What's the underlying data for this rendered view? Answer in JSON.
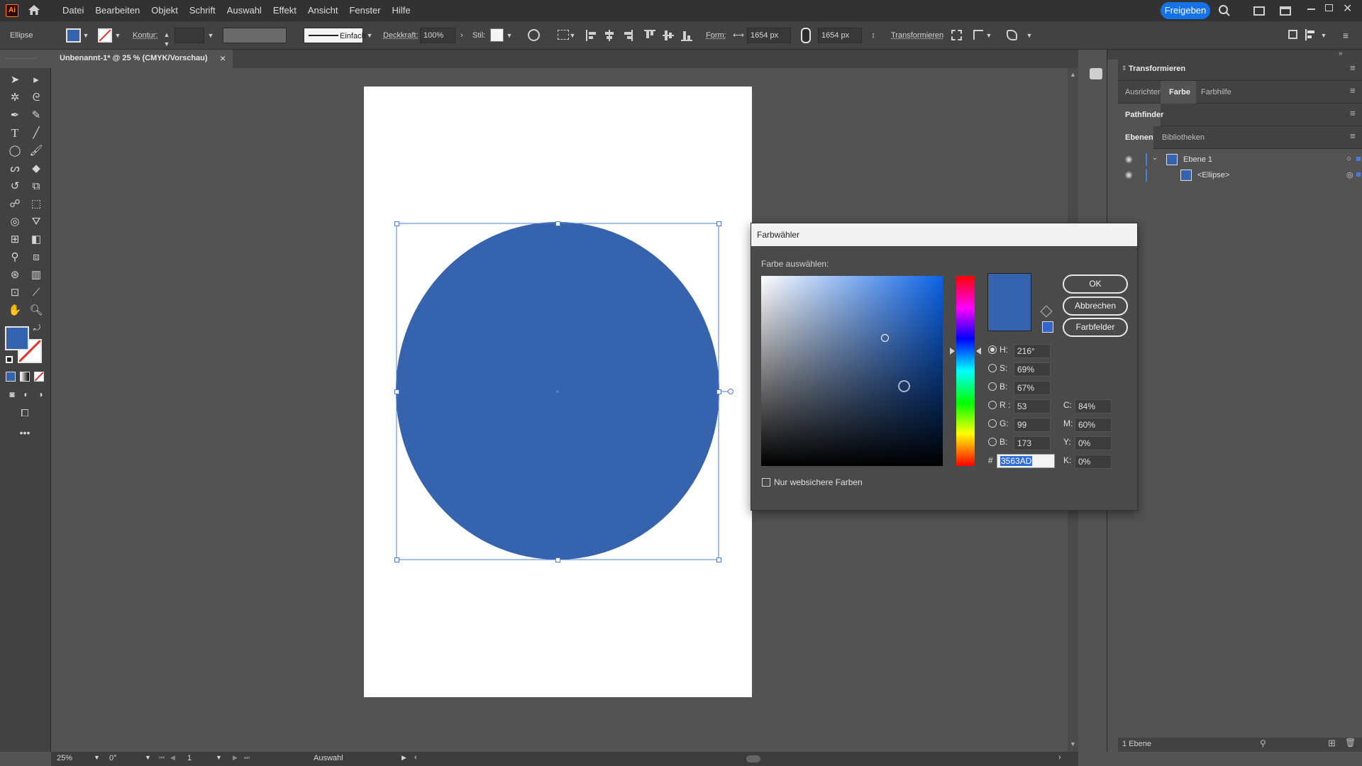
{
  "app": {
    "logo": "Ai",
    "menu": [
      "Datei",
      "Bearbeiten",
      "Objekt",
      "Schrift",
      "Auswahl",
      "Effekt",
      "Ansicht",
      "Fenster",
      "Hilfe"
    ],
    "share_button": "Freigeben"
  },
  "control_bar": {
    "object_type": "Ellipse",
    "stroke_label": "Kontur:",
    "stroke_style": "Einfach",
    "opacity_label": "Deckkraft:",
    "opacity_value": "100%",
    "style_label": "Stil:",
    "shape_label": "Form:",
    "width_value": "1654 px",
    "height_value": "1654 px",
    "transform_label": "Transformieren"
  },
  "document": {
    "tab_title": "Unbenannt-1* @ 25 % (CMYK/Vorschau)",
    "close_glyph": "×"
  },
  "status_bar": {
    "zoom": "25%",
    "rotation": "0°",
    "artboard_number": "1",
    "mode": "Auswahl"
  },
  "right_panel": {
    "transform_header": "Transformieren",
    "tabs_row1": [
      "Ausrichten",
      "Farbe",
      "Farbhilfe"
    ],
    "pathfinder_header": "Pathfinder",
    "tabs_row3": [
      "Ebenen",
      "Bibliotheken"
    ],
    "layers": [
      {
        "name": "Ebene 1"
      },
      {
        "name": "<Ellipse>"
      }
    ],
    "footer_count": "1 Ebene"
  },
  "color_picker": {
    "title": "Farbwähler",
    "subtitle": "Farbe auswählen:",
    "ok_label": "OK",
    "cancel_label": "Abbrechen",
    "swatches_label": "Farbfelder",
    "hsb": {
      "h_label": "H:",
      "h": "216°",
      "s_label": "S:",
      "s": "69%",
      "b_label": "B:",
      "b": "67%"
    },
    "rgb": {
      "r_label": "R :",
      "r": "53",
      "g_label": "G:",
      "g": "99",
      "b_label": "B:",
      "b": "173"
    },
    "cmyk": {
      "c_label": "C:",
      "c": "84%",
      "m_label": "M:",
      "m": "60%",
      "y_label": "Y:",
      "y": "0%",
      "k_label": "K:",
      "k": "0%"
    },
    "hex_label": "#",
    "hex": "3563AD",
    "web_safe_label": "Nur websichere Farben",
    "web_safe_checked": false
  },
  "colors": {
    "fill": "#3563AD",
    "accent": "#1473E6",
    "selection": "#4F7BD6"
  }
}
